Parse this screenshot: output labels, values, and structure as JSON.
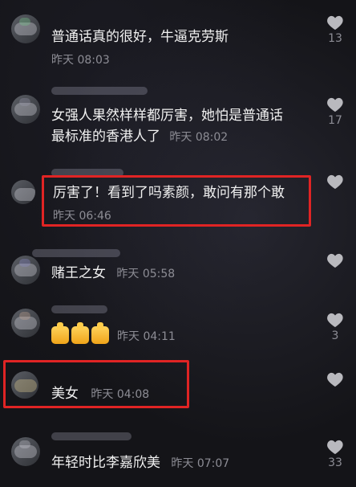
{
  "comments": [
    {
      "text": "普通话真的很好，牛逼克劳斯",
      "time": "昨天 08:03",
      "likes": "13"
    },
    {
      "text1": "女强人果然样样都厉害，她怕是普通话",
      "text2": "最标准的香港人了",
      "time": "昨天 08:02",
      "likes": "17"
    },
    {
      "text": "厉害了！看到了吗素颜，敢问有那个敢",
      "time": "昨天 06:46",
      "likes": ""
    },
    {
      "text": "赌王之女",
      "time": "昨天 05:58",
      "likes": ""
    },
    {
      "text": "",
      "time": "昨天 04:11",
      "likes": "3",
      "emoji_count": 3
    },
    {
      "text": "美女",
      "time": "昨天 04:08",
      "likes": ""
    },
    {
      "text": "年轻时比李嘉欣美",
      "time": "昨天 07:07",
      "likes": "33"
    }
  ],
  "icons": {
    "like": "heart-icon",
    "emoji": "thumbs-up-emoji"
  },
  "colors": {
    "highlight_box": "#e02424",
    "background": "#141418"
  }
}
